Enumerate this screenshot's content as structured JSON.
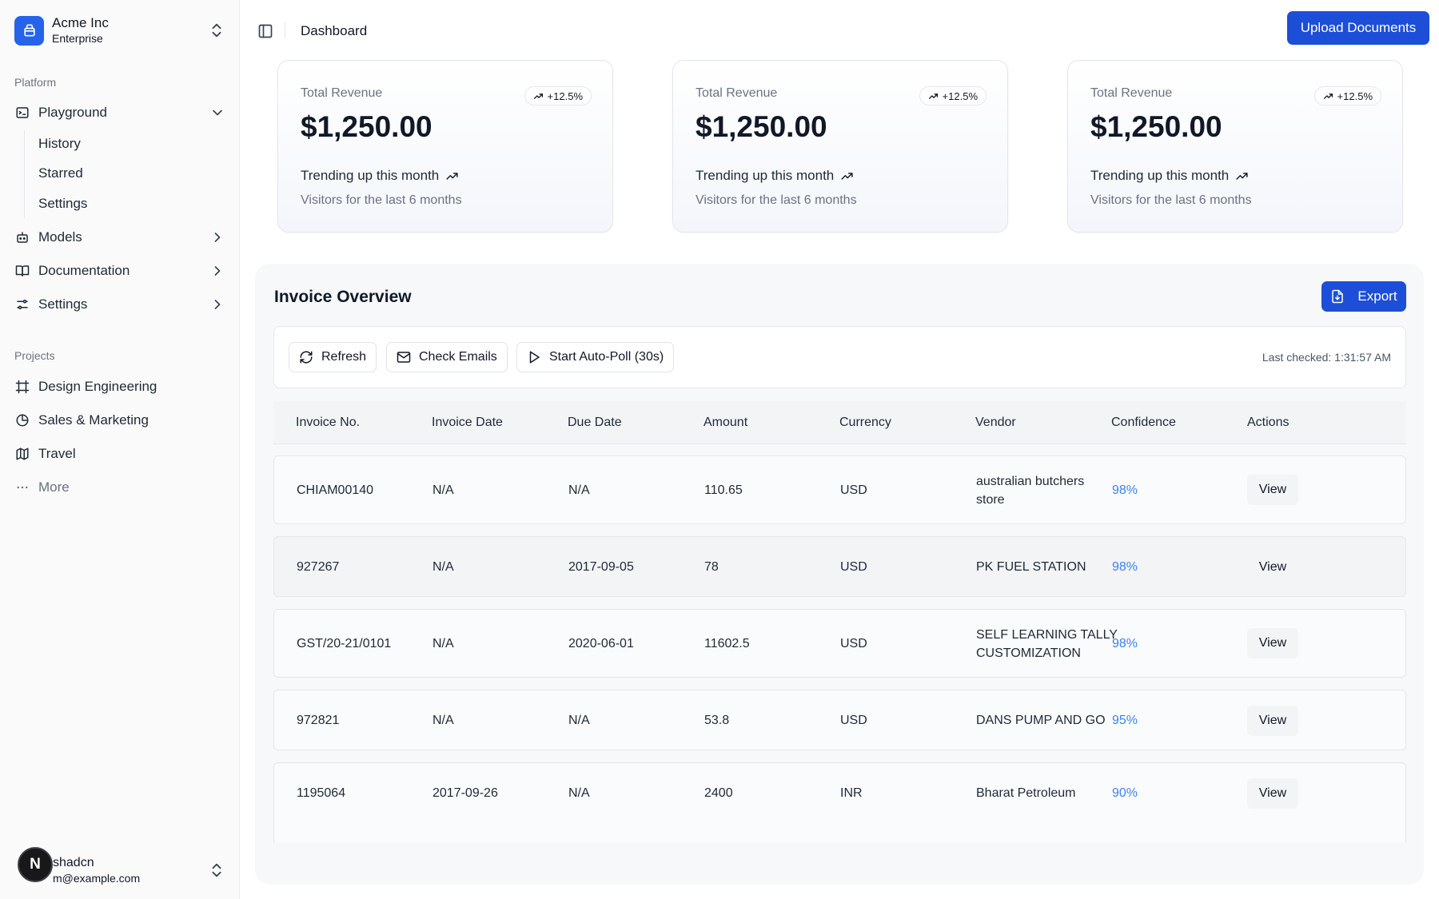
{
  "sidebar": {
    "team": {
      "name": "Acme Inc",
      "plan": "Enterprise"
    },
    "platform_label": "Platform",
    "nav": [
      {
        "label": "Playground",
        "icon": "terminal-icon",
        "expanded": true
      },
      {
        "label": "Models",
        "icon": "bot-icon"
      },
      {
        "label": "Documentation",
        "icon": "book-icon"
      },
      {
        "label": "Settings",
        "icon": "sliders-icon"
      }
    ],
    "playground_sub": [
      "History",
      "Starred",
      "Settings"
    ],
    "projects_label": "Projects",
    "projects": [
      {
        "label": "Design Engineering",
        "icon": "frame-icon"
      },
      {
        "label": "Sales & Marketing",
        "icon": "pie-chart-icon"
      },
      {
        "label": "Travel",
        "icon": "map-icon"
      }
    ],
    "more_label": "More",
    "user": {
      "initial": "N",
      "name": "shadcn",
      "email": "m@example.com"
    }
  },
  "header": {
    "breadcrumb": "Dashboard",
    "upload_label": "Upload Documents"
  },
  "cards": [
    {
      "label": "Total Revenue",
      "badge": "+12.5%",
      "value": "$1,250.00",
      "trend": "Trending up this month",
      "footer": "Visitors for the last 6 months"
    },
    {
      "label": "Total Revenue",
      "badge": "+12.5%",
      "value": "$1,250.00",
      "trend": "Trending up this month",
      "footer": "Visitors for the last 6 months"
    },
    {
      "label": "Total Revenue",
      "badge": "+12.5%",
      "value": "$1,250.00",
      "trend": "Trending up this month",
      "footer": "Visitors for the last 6 months"
    }
  ],
  "invoices": {
    "title": "Invoice Overview",
    "export_label": "Export",
    "toolbar": {
      "refresh": "Refresh",
      "check_emails": "Check Emails",
      "auto_poll": "Start Auto-Poll (30s)",
      "last_checked": "Last checked: 1:31:57 AM"
    },
    "columns": [
      "Invoice No.",
      "Invoice Date",
      "Due Date",
      "Amount",
      "Currency",
      "Vendor",
      "Confidence",
      "Actions"
    ],
    "rows": [
      {
        "invoice_no": "CHIAM00140",
        "invoice_date": "N/A",
        "due_date": "N/A",
        "amount": "110.65",
        "currency": "USD",
        "vendor_lines": [
          "australian butchers",
          "store"
        ],
        "confidence": "98%",
        "action": "View"
      },
      {
        "invoice_no": "927267",
        "invoice_date": "N/A",
        "due_date": "2017-09-05",
        "amount": "78",
        "currency": "USD",
        "vendor_lines": [
          "PK FUEL STATION"
        ],
        "confidence": "98%",
        "action": "View"
      },
      {
        "invoice_no": "GST/20-21/0101",
        "invoice_date": "N/A",
        "due_date": "2020-06-01",
        "amount": "11602.5",
        "currency": "USD",
        "vendor_lines": [
          "SELF LEARNING TALLY",
          "CUSTOMIZATION"
        ],
        "confidence": "98%",
        "action": "View"
      },
      {
        "invoice_no": "972821",
        "invoice_date": "N/A",
        "due_date": "N/A",
        "amount": "53.8",
        "currency": "USD",
        "vendor_lines": [
          "DANS PUMP AND GO"
        ],
        "confidence": "95%",
        "action": "View"
      },
      {
        "invoice_no": "1195064",
        "invoice_date": "2017-09-26",
        "due_date": "N/A",
        "amount": "2400",
        "currency": "INR",
        "vendor_lines": [
          "Bharat Petroleum"
        ],
        "confidence": "90%",
        "action": "View"
      }
    ]
  },
  "colors": {
    "primary": "#1d4ed8",
    "confidence": "#3b82f6",
    "sidebar_bg": "#fafafa"
  }
}
